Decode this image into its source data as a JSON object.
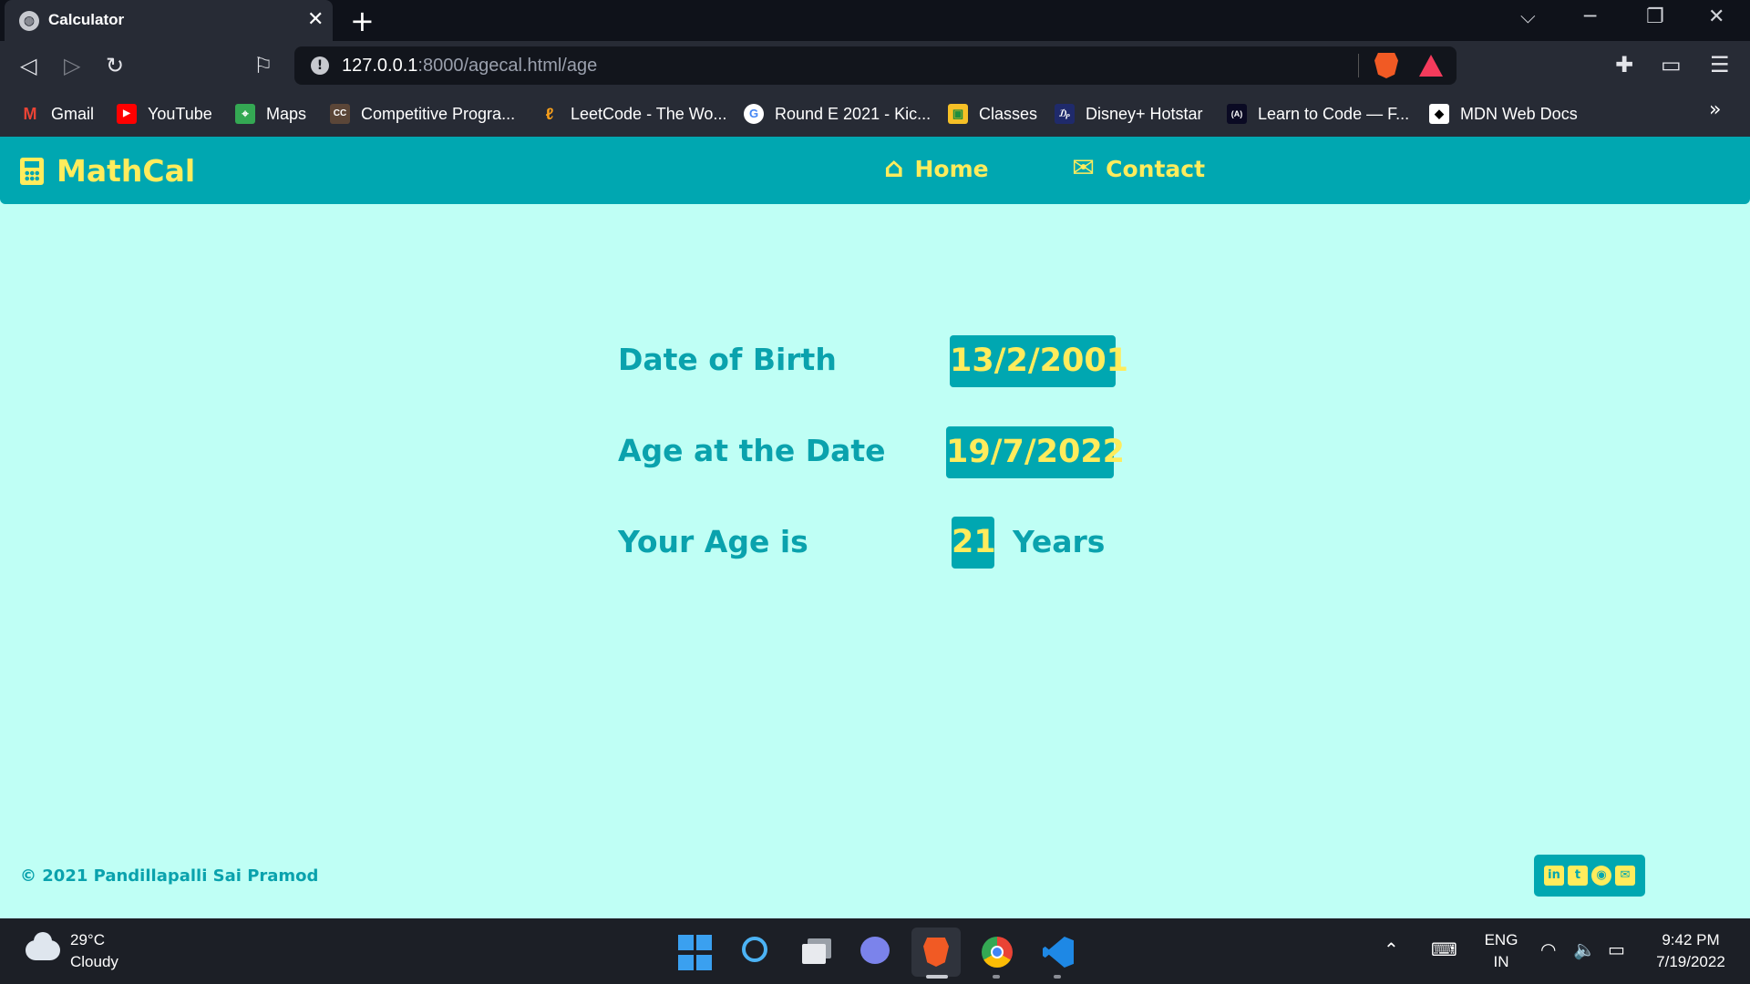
{
  "browser": {
    "tab_title": "Calculator",
    "new_tab_glyph": "+",
    "url_host": "127.0.0.1",
    "url_rest": ":8000/agecal.html/age",
    "bookmarks": [
      {
        "label": "Gmail",
        "icon": "gmail-icon",
        "color": "#ea4335",
        "glyph": "M"
      },
      {
        "label": "YouTube",
        "icon": "youtube-icon",
        "color": "#ff0000",
        "glyph": "▶"
      },
      {
        "label": "Maps",
        "icon": "maps-icon",
        "color": "#34a853",
        "glyph": "⌖"
      },
      {
        "label": "Competitive Progra...",
        "icon": "codechef-icon",
        "color": "#5b4638",
        "glyph": "CC"
      },
      {
        "label": "LeetCode - The Wo...",
        "icon": "leetcode-icon",
        "color": "#f89f1b",
        "glyph": "ℓ"
      },
      {
        "label": "Round E 2021 - Kic...",
        "icon": "google-icon",
        "color": "#4285f4",
        "glyph": "G"
      },
      {
        "label": "Classes",
        "icon": "classroom-icon",
        "color": "#f6c026",
        "glyph": "▣"
      },
      {
        "label": "Disney+ Hotstar",
        "icon": "hotstar-icon",
        "color": "#1f2a6b",
        "glyph": "₯"
      },
      {
        "label": "Learn to Code — F...",
        "icon": "freecodecamp-icon",
        "color": "#0a0a23",
        "glyph": "(A)"
      },
      {
        "label": "MDN Web Docs",
        "icon": "mdn-icon",
        "color": "#000000",
        "glyph": "◆"
      }
    ],
    "more_glyph": "»"
  },
  "site": {
    "brand": "MathCal",
    "nav": [
      {
        "label": "Home",
        "icon": "home-icon",
        "glyph": "⌂"
      },
      {
        "label": "Contact",
        "icon": "envelope-icon",
        "glyph": "✉"
      }
    ],
    "rows": {
      "dob_label": "Date of Birth",
      "dob_value": "13/2/2001",
      "date_label": "Age at the Date",
      "date_value": "19/7/2022",
      "age_label": "Your Age is",
      "age_value": "21",
      "age_unit": "Years"
    },
    "footer": {
      "copyright": "© 2021 Pandillapalli Sai Pramod",
      "social": [
        "linkedin-icon",
        "twitter-icon",
        "github-icon",
        "mail-icon"
      ],
      "social_glyphs": [
        "in",
        "t",
        "◉",
        "✉"
      ]
    },
    "colors": {
      "background": "#bffff5",
      "header": "#00a7b1",
      "accent_yellow": "#ffec5c",
      "text_teal": "#0aa2ad"
    }
  },
  "taskbar": {
    "temperature": "29°C",
    "condition": "Cloudy",
    "lang_top": "ENG",
    "lang_bottom": "IN",
    "time": "9:42 PM",
    "date": "7/19/2022"
  }
}
